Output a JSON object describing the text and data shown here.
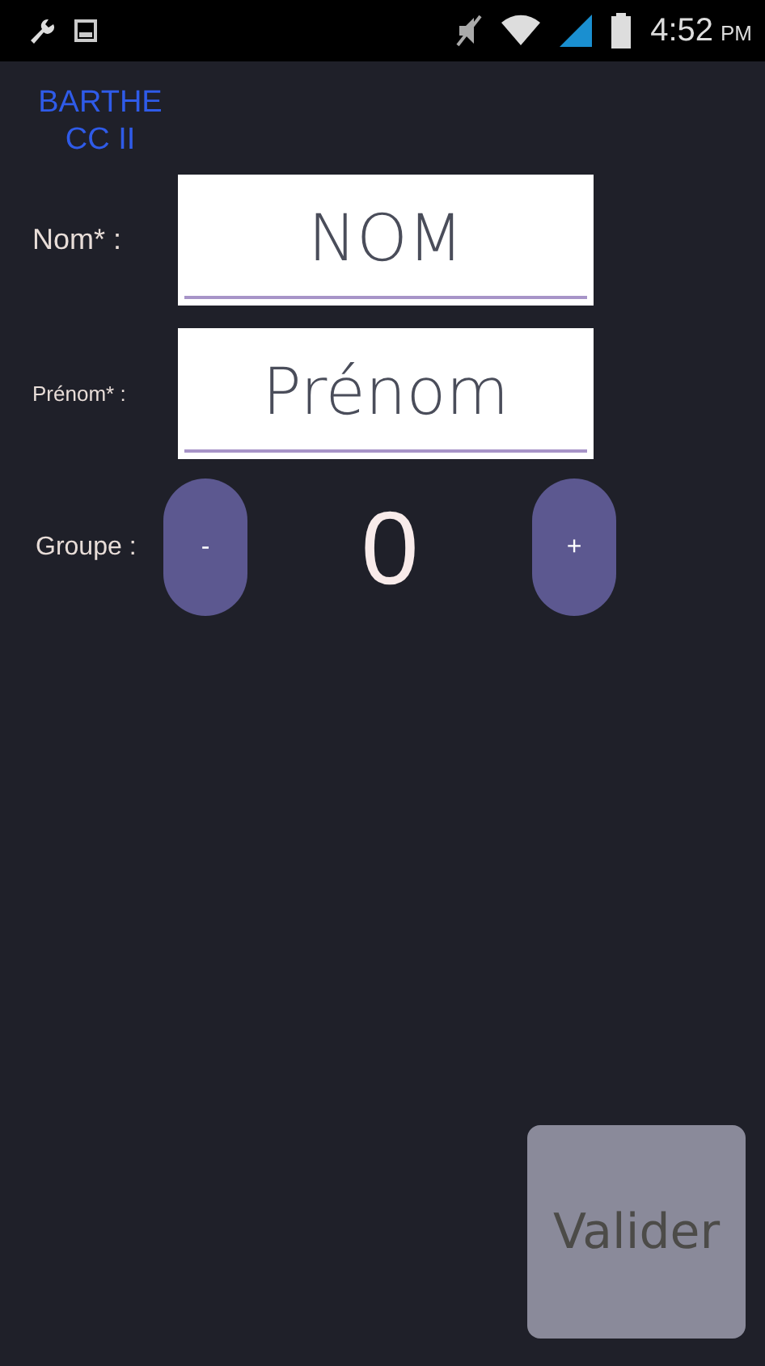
{
  "status_bar": {
    "time": "4:52",
    "meridiem": "PM"
  },
  "title": {
    "lines": [
      "BARTHE",
      "CC II"
    ]
  },
  "fields": [
    {
      "label": "Nom* :",
      "placeholder": "NOM"
    },
    {
      "label": "Prénom* :",
      "placeholder": "Prénom"
    }
  ],
  "group": {
    "label": "Groupe :",
    "minus": "-",
    "value": "0",
    "plus": "+"
  },
  "submit": {
    "label": "Valider",
    "disabled": true
  }
}
